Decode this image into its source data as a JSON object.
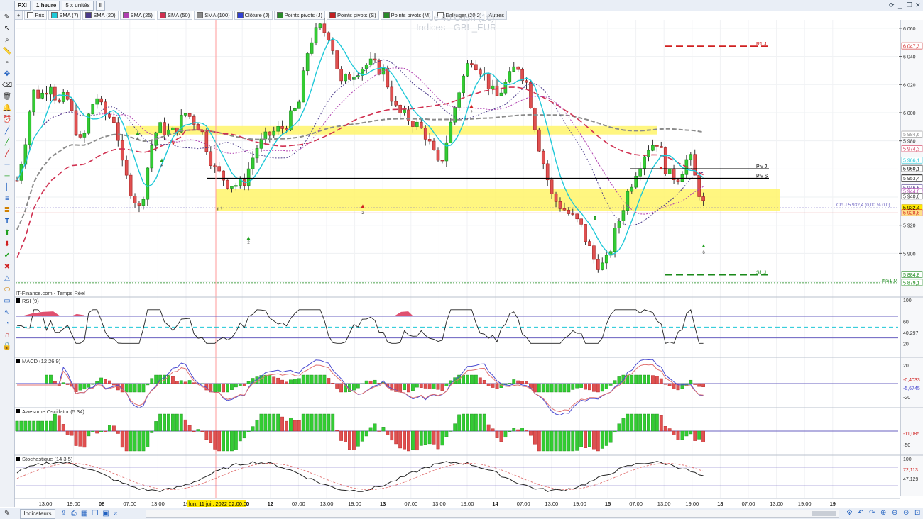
{
  "toolbar": {
    "symbol": "PXI",
    "period": "1 heure",
    "units": "5 x unités"
  },
  "indicators": [
    {
      "label": "Prix",
      "color": "#ffffff"
    },
    {
      "label": "SMA (7)",
      "color": "#1ec8d8"
    },
    {
      "label": "SMA (20)",
      "color": "#4a3a8a"
    },
    {
      "label": "SMA (25)",
      "color": "#b040b0"
    },
    {
      "label": "SMA (50)",
      "color": "#d03050"
    },
    {
      "label": "SMA (100)",
      "color": "#8a8a8a"
    },
    {
      "label": "Clôture (J)",
      "color": "#3040d0"
    },
    {
      "label": "Points pivots (J)",
      "color": "#2a8a2a"
    },
    {
      "label": "Points pivots (S)",
      "color": "#c02020"
    },
    {
      "label": "Points pivots (M)",
      "color": "#2a8a2a"
    },
    {
      "label": "Bollinger (20 2)",
      "color": "#ffffff"
    }
  ],
  "others_label": "Autres",
  "instrument_title": "ce 40 Cash (1€)",
  "instrument_subtitle": "Indices - GBL_EUR",
  "source_label": "IT-Finance.com - Temps Réel",
  "panels": {
    "rsi": "RSI (9)",
    "macd": "MACD (12 26 9)",
    "ao": "Awesome Oscillator (5 34)",
    "stoch": "Stochastique (14 3 5)"
  },
  "cursor_date": "lun. 11 juil. 2022 02:00:00",
  "bottom": {
    "indicators_button": "Indicateurs"
  },
  "chart_data": {
    "type": "candlestick",
    "price_axis": {
      "ticks": [
        "6 060",
        "6 040",
        "6 020",
        "6 000",
        "5 980",
        "5 920",
        "5 900"
      ],
      "ylim": [
        5876,
        6066
      ]
    },
    "time_axis_labels": [
      "13:00",
      "19:00",
      "08",
      "07:00",
      "13:00",
      "19",
      "13:00",
      "19:00",
      "12",
      "07:00",
      "13:00",
      "19:00",
      "13",
      "07:00",
      "13:00",
      "19:00",
      "14",
      "07:00",
      "13:00",
      "19:00",
      "15",
      "07:00",
      "13:00",
      "19:00",
      "18",
      "07:00",
      "13:00",
      "19:00",
      "19"
    ],
    "levels": [
      {
        "name": "R1 J",
        "value": "6 047,3",
        "color": "#d02020"
      },
      {
        "name": "Piv J",
        "value": "5 960,1",
        "color": "#000000"
      },
      {
        "name": "Piv S",
        "value": "5 953,4",
        "color": "#000000"
      },
      {
        "name": "S1 J",
        "value": "5 884,8",
        "color": "#1a8a1a"
      },
      {
        "name": "mS1 M",
        "value": "5 879,1",
        "color": "#1a8a1a"
      }
    ],
    "right_labels": [
      "5 984,6",
      "5 980",
      "5 974,3",
      "5 966,1",
      "5 953,4",
      "5 946,6",
      "5 944,0",
      "5 940,6",
      "5 932,4",
      "5 928,8"
    ],
    "last_close_label": "Clo J 5 932,4 (0,00 % 0,0)",
    "rsi": {
      "ticks": [
        "100",
        "60",
        "40,297",
        "20"
      ],
      "levels": [
        70,
        50,
        30
      ]
    },
    "macd": {
      "ticks": [
        "20",
        "-0,4033",
        "-5,6745",
        "-20"
      ]
    },
    "ao": {
      "ticks": [
        "-11,085",
        "-50"
      ]
    },
    "stochastic": {
      "ticks": [
        "100",
        "72,113",
        "47,129"
      ]
    }
  }
}
